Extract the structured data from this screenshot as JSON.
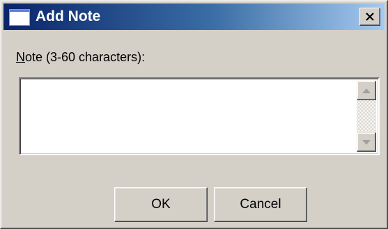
{
  "window": {
    "title": "Add Note",
    "icon": "window-icon",
    "close_icon": "close-icon"
  },
  "form": {
    "note_label_mnemonic": "N",
    "note_label_rest": "ote (3-60 characters):",
    "note_value": ""
  },
  "buttons": {
    "ok_label": "OK",
    "cancel_label": "Cancel"
  },
  "colors": {
    "titlebar_start": "#0a246a",
    "titlebar_end": "#a6caf0",
    "face": "#d4d0c8"
  }
}
